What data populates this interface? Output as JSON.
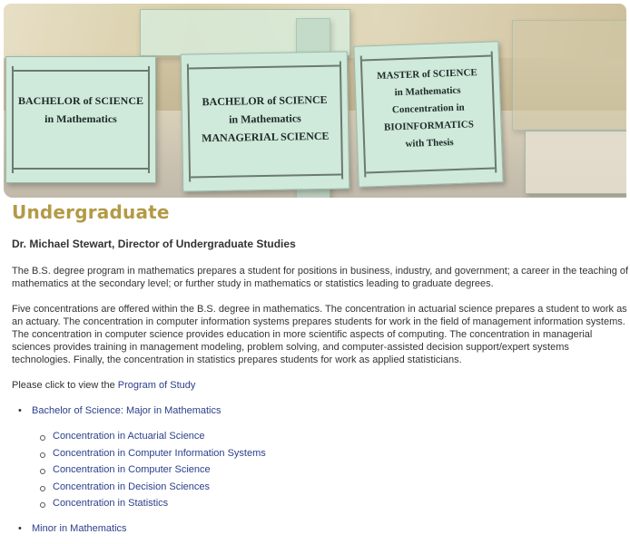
{
  "banner": {
    "cards": [
      {
        "lines": [
          "BACHELOR of SCIENCE",
          "in Mathematics"
        ]
      },
      {
        "lines": [
          "BACHELOR of SCIENCE",
          "in Mathematics",
          "MANAGERIAL SCIENCE"
        ]
      },
      {
        "lines": [
          "MASTER of SCIENCE",
          "in Mathematics",
          "Concentration in",
          "BIOINFORMATICS",
          "with Thesis"
        ]
      }
    ]
  },
  "page": {
    "title": "Undergraduate",
    "director": "Dr.  Michael Stewart, Director of Undergraduate Studies",
    "intro": "The B.S. degree program in mathematics prepares a student for positions in business, industry, and government; a career in the teaching of mathematics at the secondary level; or further study in mathematics or statistics leading to graduate degrees.",
    "concentrations_text": "Five concentrations are offered within the B.S. degree in mathematics. The concentration in actuarial science prepares a student to work as an actuary. The concentration in computer information systems prepares students for work in the field of management information systems. The concentration in computer science provides education in more scientific aspects of computing. The concentration in managerial sciences provides training in management modeling, problem solving, and computer-assisted decision support/expert systems technologies. Finally, the concentration in statistics prepares students for work as applied statisticians.",
    "click_prefix": "Please click to view the ",
    "program_link": "Program of Study"
  },
  "links": {
    "bachelor": "Bachelor of Science: Major in Mathematics",
    "concentrations": [
      "Concentration in Actuarial Science",
      "Concentration in Computer Information Systems",
      "Concentration in Computer Science",
      "Concentration in Decision Sciences",
      "Concentration in Statistics"
    ],
    "minor": "Minor in Mathematics"
  }
}
